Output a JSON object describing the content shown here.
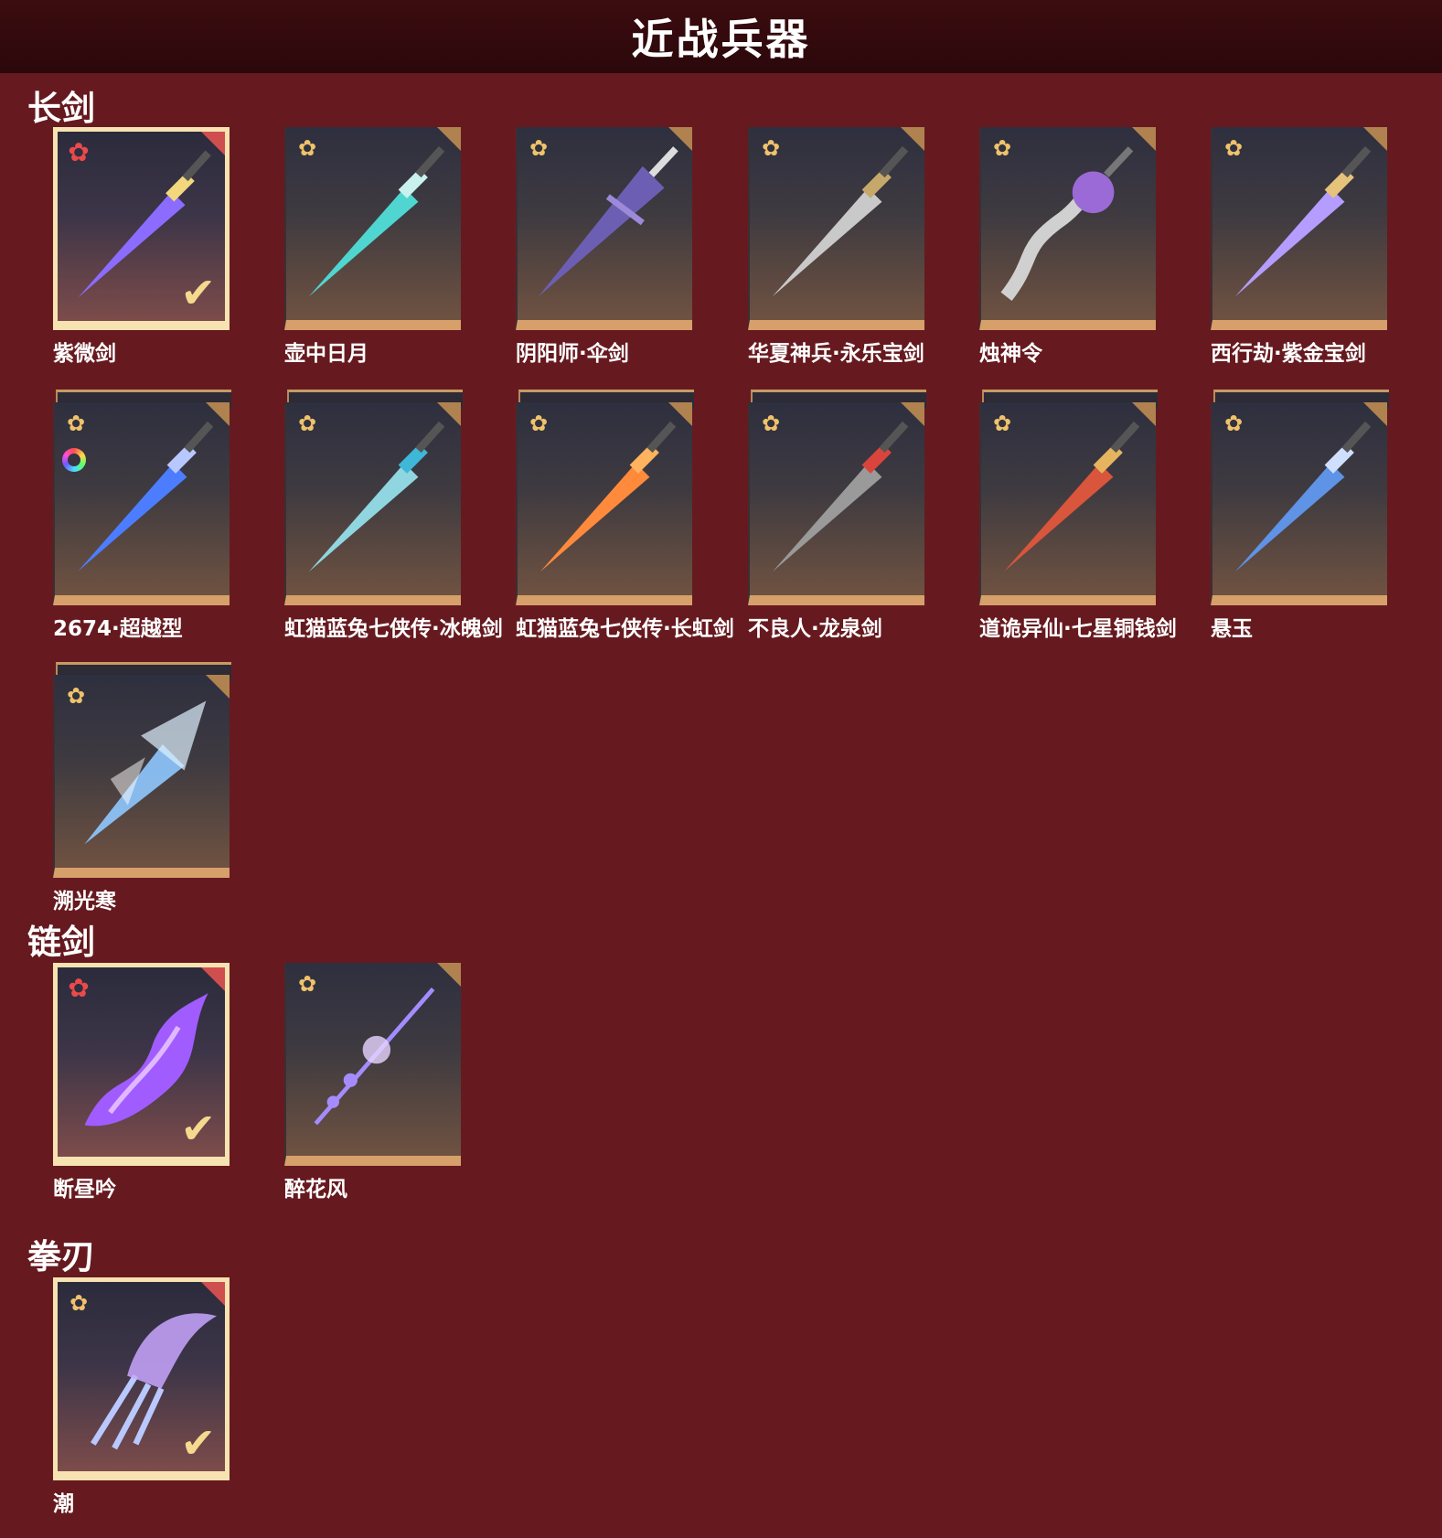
{
  "page": {
    "title": "近战兵器"
  },
  "sections": [
    {
      "title": "长剑"
    },
    {
      "title": "链剑"
    },
    {
      "title": "拳刃"
    }
  ],
  "items": [
    {
      "name": "紫微剑",
      "badge": "red-flower-icon",
      "selected": true
    },
    {
      "name": "壶中日月",
      "badge": "gold-flower-icon",
      "selected": false
    },
    {
      "name": "阴阳师·伞剑",
      "badge": "gold-flower-icon",
      "selected": false
    },
    {
      "name": "华夏神兵·永乐宝剑",
      "badge": "gold-flower-icon",
      "selected": false
    },
    {
      "name": "烛神令",
      "badge": "gold-flower-icon",
      "selected": false
    },
    {
      "name": "西行劫·紫金宝剑",
      "badge": "gold-flower-icon",
      "selected": false
    },
    {
      "name": "2674·超越型",
      "badge": "gold-flower-icon",
      "selected": false,
      "dye_icon": "color-ring-icon"
    },
    {
      "name": "虹猫蓝兔七侠传·冰魄剑",
      "badge": "gold-flower-icon",
      "selected": false
    },
    {
      "name": "虹猫蓝兔七侠传·长虹剑",
      "badge": "gold-flower-icon",
      "selected": false
    },
    {
      "name": "不良人·龙泉剑",
      "badge": "gold-flower-icon",
      "selected": false
    },
    {
      "name": "道诡异仙·七星铜钱剑",
      "badge": "gold-flower-icon",
      "selected": false
    },
    {
      "name": "悬玉",
      "badge": "gold-flower-icon",
      "selected": false
    },
    {
      "name": "溯光寒",
      "badge": "gold-flower-icon",
      "selected": false
    },
    {
      "name": "断昼吟",
      "badge": "red-flower-icon",
      "selected": true
    },
    {
      "name": "醉花风",
      "badge": "gold-flower-icon",
      "selected": false
    },
    {
      "name": "潮",
      "badge": "gold-flower-icon",
      "selected": true
    }
  ],
  "icons": {
    "badge_symbol": "✿",
    "check_symbol": "✔"
  },
  "colors": {
    "background": "#661a1f",
    "header": "#2b080b",
    "card_accent": "#d7a06a",
    "selected_border": "#f7e2b2",
    "badge_gold": "#f0c36b",
    "badge_red": "#ec4a4a"
  }
}
